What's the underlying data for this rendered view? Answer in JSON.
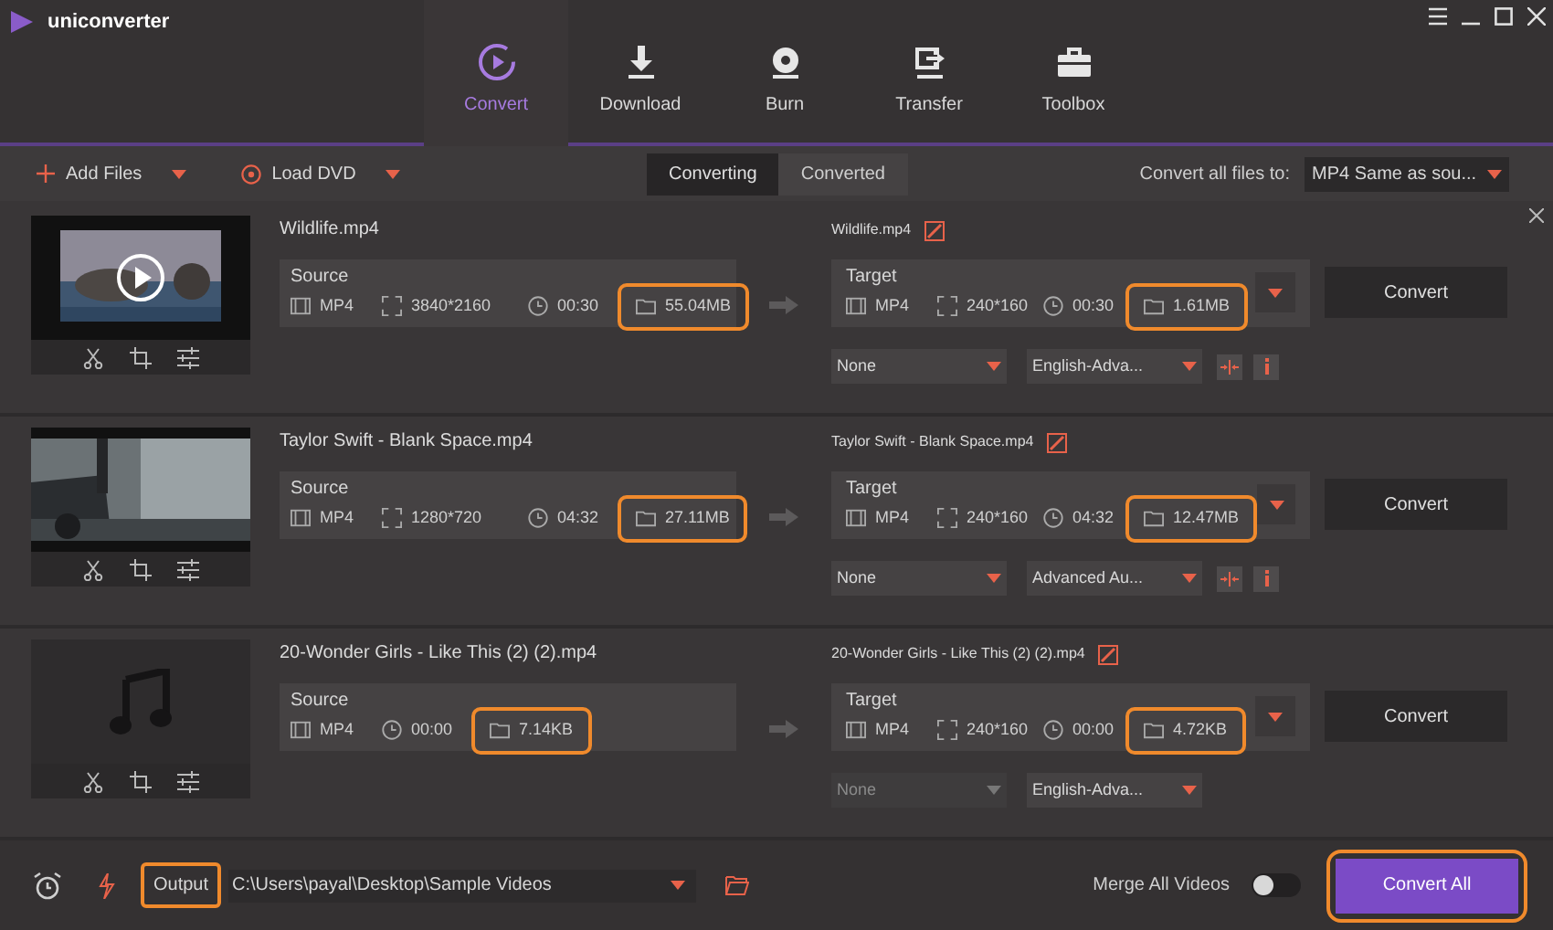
{
  "app": {
    "title": "uniconverter"
  },
  "nav_tabs": [
    {
      "label": "Convert",
      "kind": "convert",
      "selected": true
    },
    {
      "label": "Download",
      "kind": "download",
      "selected": false
    },
    {
      "label": "Burn",
      "kind": "burn",
      "selected": false
    },
    {
      "label": "Transfer",
      "kind": "transfer",
      "selected": false
    },
    {
      "label": "Toolbox",
      "kind": "toolbox",
      "selected": false
    }
  ],
  "toolbar": {
    "add_files": "Add Files",
    "load_dvd": "Load DVD",
    "mode_tabs": [
      {
        "label": "Converting",
        "selected": true
      },
      {
        "label": "Converted",
        "selected": false
      }
    ],
    "convert_all_label": "Convert all files to:",
    "format": "MP4 Same as sou..."
  },
  "files": [
    {
      "name": "Wildlife.mp4",
      "thumbnail": {
        "kind": "video"
      },
      "source": {
        "label": "Source",
        "format": "MP4",
        "resolution": "3840*2160",
        "duration": "00:30",
        "size": "55.04MB",
        "size_highlighted": true
      },
      "target": {
        "name": "Wildlife.mp4",
        "label": "Target",
        "format": "MP4",
        "resolution": "240*160",
        "duration": "00:30",
        "size": "1.61MB",
        "size_highlighted": true
      },
      "subtitle": {
        "value": "None",
        "disabled": false
      },
      "audio": {
        "value": "English-Adva..."
      },
      "extra_tools": true,
      "convert": "Convert"
    },
    {
      "name": "Taylor Swift - Blank Space.mp4",
      "thumbnail": {
        "kind": "video"
      },
      "source": {
        "label": "Source",
        "format": "MP4",
        "resolution": "1280*720",
        "duration": "04:32",
        "size": "27.11MB",
        "size_highlighted": true
      },
      "target": {
        "name": "Taylor Swift - Blank Space.mp4",
        "label": "Target",
        "format": "MP4",
        "resolution": "240*160",
        "duration": "04:32",
        "size": "12.47MB",
        "size_highlighted": true
      },
      "subtitle": {
        "value": "None",
        "disabled": false
      },
      "audio": {
        "value": "Advanced Au..."
      },
      "extra_tools": true,
      "convert": "Convert"
    },
    {
      "name": "20-Wonder Girls - Like This (2) (2).mp4",
      "thumbnail": {
        "kind": "audio"
      },
      "source": {
        "label": "Source",
        "format": "MP4",
        "duration": "00:00",
        "size": "7.14KB",
        "size_highlighted": true
      },
      "target": {
        "name": "20-Wonder Girls - Like This (2) (2).mp4",
        "label": "Target",
        "format": "MP4",
        "resolution": "240*160",
        "duration": "00:00",
        "size": "4.72KB",
        "size_highlighted": true
      },
      "subtitle": {
        "value": "None",
        "disabled": true
      },
      "audio": {
        "value": "English-Adva..."
      },
      "extra_tools": false,
      "convert": "Convert"
    }
  ],
  "footer": {
    "output_label": "Output",
    "output_highlighted": true,
    "path": "C:\\Users\\payal\\Desktop\\Sample Videos",
    "merge_label": "Merge All Videos",
    "merge_on": false,
    "convert_all": "Convert All",
    "convert_all_highlighted": true
  }
}
